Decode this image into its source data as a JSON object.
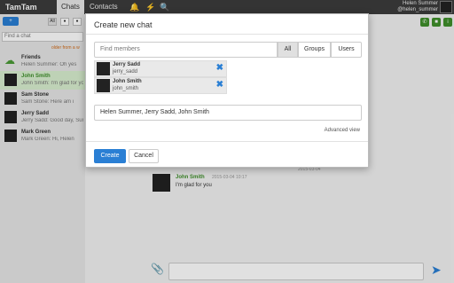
{
  "topbar": {
    "brand": "TamTam",
    "tabs": [
      {
        "label": "Chats",
        "active": true
      },
      {
        "label": "Contacts",
        "active": false
      }
    ],
    "icons": [
      "bell-icon",
      "bolt-icon",
      "search-icon"
    ],
    "user": {
      "name": "Helen Summer",
      "login": "@helen_summer"
    }
  },
  "left": {
    "new_button_label": "+",
    "filters": [
      "All"
    ],
    "search_placeholder": "Find a chat",
    "older_label": "older from a w",
    "chats": [
      {
        "name": "Friends",
        "preview": "Helen Summer: Oh yes",
        "type": "group"
      },
      {
        "name": "John Smith",
        "preview": "John Smith: I'm glad for you",
        "active": true
      },
      {
        "name": "Sam Stone",
        "preview": "Sam Stone: Here am i"
      },
      {
        "name": "Jerry Sadd",
        "preview": "Jerry Sadd: Good day, Sun"
      },
      {
        "name": "Mark Green",
        "preview": "Mark Green: Hi, Helen"
      }
    ]
  },
  "conversation": {
    "date_label": "2015-03-04",
    "message": {
      "author": "John Smith",
      "time": "2015-03-04 10:17",
      "text": "I'm glad for you"
    }
  },
  "modal": {
    "title": "Create new chat",
    "search_placeholder": "Find members",
    "filters": [
      "All",
      "Groups",
      "Users"
    ],
    "selected_filter": "All",
    "members": [
      {
        "name": "Jerry Sadd",
        "login": "jerry_sadd"
      },
      {
        "name": "John Smith",
        "login": "john_smith"
      }
    ],
    "chat_name": "Helen Summer, Jerry Sadd, John Smith",
    "advanced_link": "Advanced view",
    "create_label": "Create",
    "cancel_label": "Cancel"
  },
  "colors": {
    "accent": "#2a7fd4",
    "active_green": "#3f8f2b",
    "topbar": "#3c3c3c"
  }
}
